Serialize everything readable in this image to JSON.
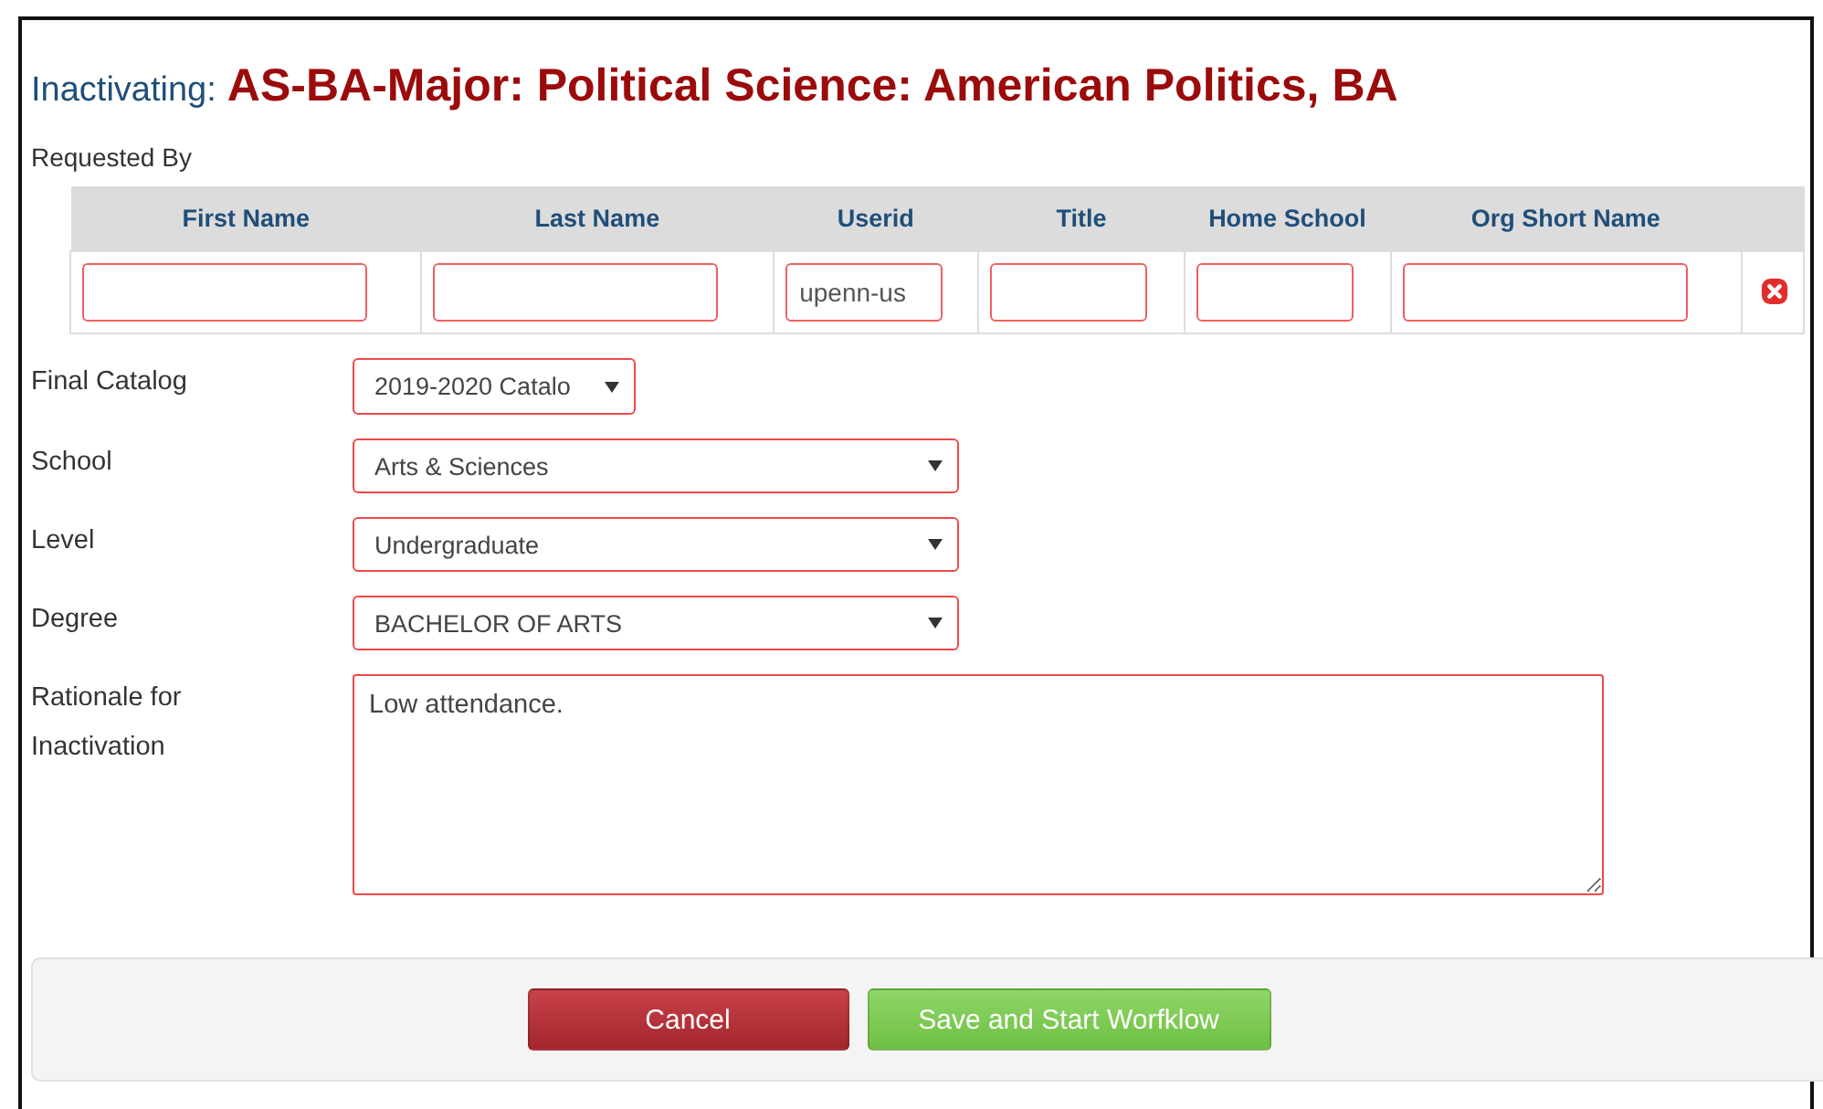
{
  "heading": {
    "prefix": "Inactivating:",
    "title": "AS-BA-Major: Political Science: American Politics, BA"
  },
  "requested_by": {
    "label": "Requested By",
    "columns": [
      {
        "label": "First Name"
      },
      {
        "label": "Last Name"
      },
      {
        "label": "Userid",
        "value": "upenn-us"
      },
      {
        "label": "Title"
      },
      {
        "label": "Home School"
      },
      {
        "label": "Org Short Name"
      }
    ]
  },
  "final_catalog": {
    "label": "Final Catalog",
    "value": "2019-2020 Catalo"
  },
  "selects": [
    {
      "label": "School",
      "value": "Arts & Sciences"
    },
    {
      "label": "Level",
      "value": "Undergraduate"
    },
    {
      "label": "Degree",
      "value": "BACHELOR OF ARTS"
    }
  ],
  "rationale": {
    "label": "Rationale for Inactivation",
    "value": "Low attendance."
  },
  "buttons": [
    {
      "label": "Cancel",
      "kind": "cancel"
    },
    {
      "label": "Save and Start Worfklow",
      "kind": "save"
    }
  ]
}
